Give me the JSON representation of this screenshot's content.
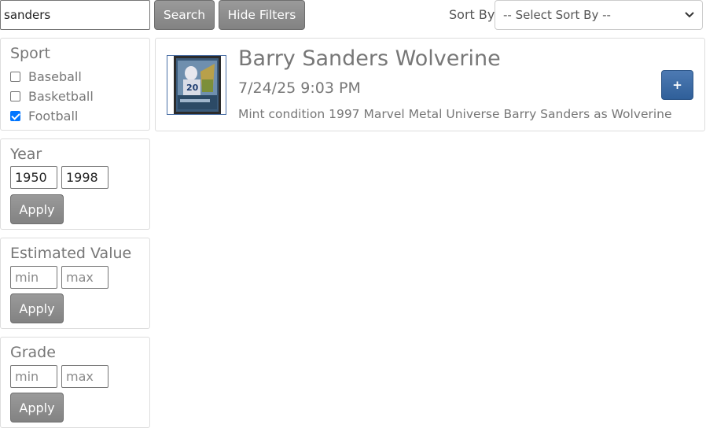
{
  "search": {
    "value": "sanders",
    "button_label": "Search"
  },
  "filters_toggle": {
    "label": "Hide Filters"
  },
  "sort": {
    "label": "Sort By",
    "selected": "-- Select Sort By --",
    "chevron_icon": "chevron-down-icon"
  },
  "filters": {
    "sport": {
      "title": "Sport",
      "options": [
        {
          "label": "Baseball",
          "checked": false
        },
        {
          "label": "Basketball",
          "checked": false
        },
        {
          "label": "Football",
          "checked": true
        }
      ]
    },
    "year": {
      "title": "Year",
      "min_value": "1950",
      "max_value": "1998",
      "apply_label": "Apply"
    },
    "estimated_value": {
      "title": "Estimated Value",
      "min_placeholder": "min",
      "max_placeholder": "max",
      "apply_label": "Apply"
    },
    "grade": {
      "title": "Grade",
      "min_placeholder": "min",
      "max_placeholder": "max",
      "apply_label": "Apply"
    }
  },
  "results": [
    {
      "title": "Barry Sanders Wolverine",
      "date": "7/24/25 9:03 PM",
      "description": "Mint condition 1997 Marvel Metal Universe Barry Sanders as Wolverine",
      "add_label": "+"
    }
  ],
  "colors": {
    "button_gray": "#8c8c8c",
    "primary_blue": "#3d6ca6",
    "checkbox_blue": "#0075ff"
  }
}
